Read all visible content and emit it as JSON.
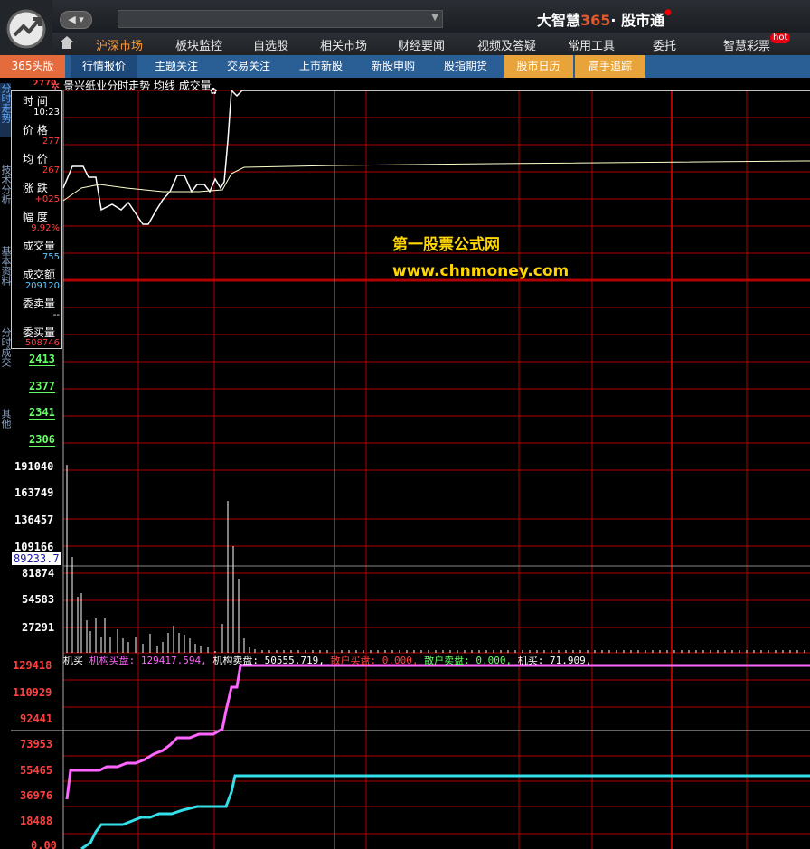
{
  "brand": {
    "prefix": "大智慧",
    "num": "365",
    "suffix": "· 股市通"
  },
  "nav_back": "◀ ▾",
  "menu": [
    {
      "label": "沪深市场",
      "active": true
    },
    {
      "label": "板块监控"
    },
    {
      "label": "自选股"
    },
    {
      "label": "相关市场"
    },
    {
      "label": "财经要闻"
    },
    {
      "label": "视频及答疑"
    },
    {
      "label": "常用工具"
    },
    {
      "label": "委托"
    },
    {
      "label": "智慧彩票"
    }
  ],
  "hot_badge": "hot",
  "subtabs": [
    {
      "label": "365头版"
    },
    {
      "label": "行情报价"
    },
    {
      "label": "主题关注"
    },
    {
      "label": "交易关注"
    },
    {
      "label": "上市新股"
    },
    {
      "label": "新股申购"
    },
    {
      "label": "股指期货"
    },
    {
      "label": "股市日历"
    },
    {
      "label": "高手追踪"
    }
  ],
  "vtabs": [
    "分时走势",
    "技术分析",
    "基本资料",
    "分时成交",
    "其他"
  ],
  "chart_title": "景兴纸业分时走势  均线  成交量",
  "info": {
    "time_label": "时 间",
    "time": "10:23",
    "price_label": "价 格",
    "price": "277",
    "avg_label": "均 价",
    "avg": "267",
    "chg_label": "涨 跌",
    "chg": "+025",
    "pct_label": "幅 度",
    "pct": "9.92%",
    "vol_label": "成交量",
    "vol": "755",
    "amt_label": "成交额",
    "amt": "209120",
    "sell_label": "委卖量",
    "sell": "--",
    "buy_label": "委买量",
    "buy": "508746"
  },
  "price_axis": {
    "top": "2770",
    "ticks": [
      "2413",
      "2377",
      "2341",
      "2306"
    ]
  },
  "volume_axis": {
    "ticks": [
      "191040",
      "163749",
      "136457",
      "109166",
      "81874",
      "54583",
      "27291"
    ],
    "current": "89233.7"
  },
  "flow_axis": {
    "ticks": [
      "129418",
      "110929",
      "92441",
      "73953",
      "55465",
      "36976",
      "18488",
      "0.00"
    ]
  },
  "legend": {
    "name": "机买",
    "inst_buy_label": "机构买盘:",
    "inst_buy": "129417.594,",
    "inst_sell_label": "机构卖盘:",
    "inst_sell": "50555.719,",
    "retail_buy_label": "散户买盘:",
    "retail_buy": "0.000,",
    "retail_sell_label": "散户卖盘:",
    "retail_sell": "0.000,",
    "jimai_label": "机买:",
    "jimai": "71.909,"
  },
  "watermark": {
    "line1": "第一股票公式网",
    "line2": "www.chnmoney.com"
  },
  "colors": {
    "grid": "#b00000",
    "price_line": "#ffffff",
    "avg_line": "#ffffcc",
    "inst_buy": "#ff66ff",
    "inst_sell": "#33e0e8",
    "up_text": "#ff4040",
    "down_text": "#66ff66"
  }
}
